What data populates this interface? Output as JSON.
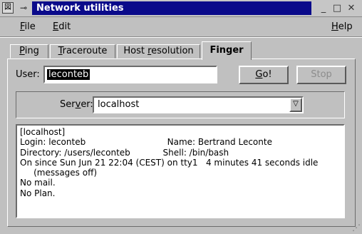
{
  "window": {
    "title": "Network utilities",
    "sys_glyph": "図",
    "pin_glyph": "⊸",
    "min_glyph": "_",
    "max_glyph": "□",
    "close_glyph": "✕"
  },
  "menubar": {
    "file": {
      "mnemonic": "F",
      "rest": "ile"
    },
    "edit": {
      "mnemonic": "E",
      "rest": "dit"
    },
    "help": {
      "mnemonic": "H",
      "rest": "elp"
    }
  },
  "tabs": [
    {
      "mnemonic": "P",
      "rest": "ing"
    },
    {
      "mnemonic": "T",
      "rest": "raceroute"
    },
    {
      "pre": "Host ",
      "mnemonic": "r",
      "rest": "esolution"
    },
    {
      "label": "Finger",
      "active": true
    }
  ],
  "form": {
    "user_label": "User:",
    "user_value": "leconteb",
    "go_button": {
      "mnemonic": "G",
      "rest": "o!"
    },
    "stop_button": "Stop",
    "server_label_pre": "Ser",
    "server_label_mnemonic": "v",
    "server_label_rest": "er:",
    "server_value": "localhost",
    "combo_glyph": "▽"
  },
  "output": "[localhost]\nLogin: leconteb                              Name: Bertrand Leconte\nDirectory: /users/leconteb            Shell: /bin/bash\nOn since Sun Jun 21 22:04 (CEST) on tty1   4 minutes 41 seconds idle\n     (messages off)\nNo mail.\nNo Plan.",
  "colors": {
    "title_bar": "#0a0a8a",
    "face": "#c0c0c0",
    "selection": "#000000"
  }
}
